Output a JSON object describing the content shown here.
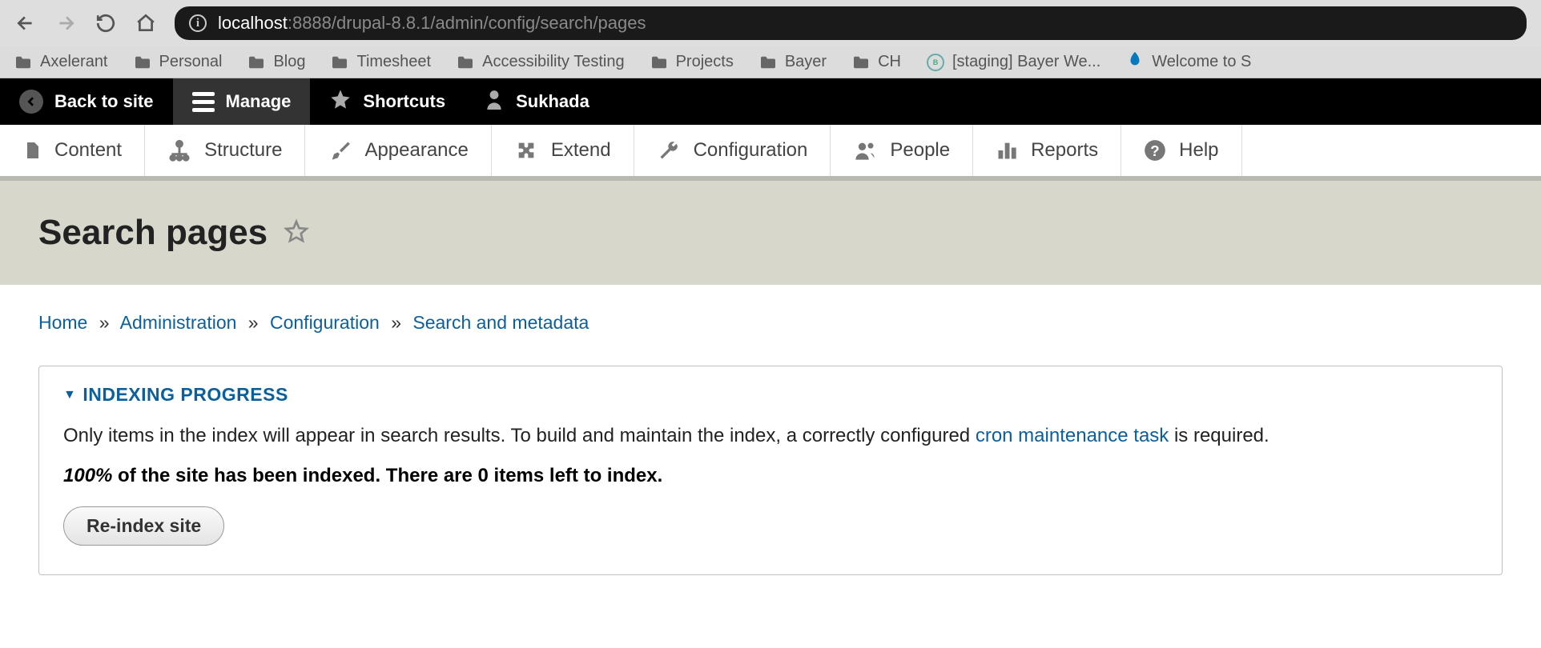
{
  "browser": {
    "url_host": "localhost",
    "url_rest": ":8888/drupal-8.8.1/admin/config/search/pages"
  },
  "bookmarks": [
    {
      "type": "folder",
      "label": "Axelerant"
    },
    {
      "type": "folder",
      "label": "Personal"
    },
    {
      "type": "folder",
      "label": "Blog"
    },
    {
      "type": "folder",
      "label": "Timesheet"
    },
    {
      "type": "folder",
      "label": "Accessibility Testing"
    },
    {
      "type": "folder",
      "label": "Projects"
    },
    {
      "type": "folder",
      "label": "Bayer"
    },
    {
      "type": "folder",
      "label": "CH"
    },
    {
      "type": "bayer",
      "label": "[staging] Bayer We..."
    },
    {
      "type": "drupal",
      "label": "Welcome to S"
    }
  ],
  "toolbar": {
    "back_to_site": "Back to site",
    "manage": "Manage",
    "shortcuts": "Shortcuts",
    "user": "Sukhada"
  },
  "menu": [
    {
      "label": "Content"
    },
    {
      "label": "Structure"
    },
    {
      "label": "Appearance"
    },
    {
      "label": "Extend"
    },
    {
      "label": "Configuration"
    },
    {
      "label": "People"
    },
    {
      "label": "Reports"
    },
    {
      "label": "Help"
    }
  ],
  "page": {
    "title": "Search pages"
  },
  "breadcrumb": {
    "home": "Home",
    "admin": "Administration",
    "config": "Configuration",
    "search": "Search and metadata"
  },
  "indexing": {
    "legend": "INDEXING PROGRESS",
    "desc_pre": "Only items in the index will appear in search results. To build and maintain the index, a correctly configured ",
    "desc_link": "cron maintenance task",
    "desc_post": " is required.",
    "status_pct": "100%",
    "status_rest": " of the site has been indexed. There are 0 items left to index.",
    "reindex_button": "Re-index site"
  }
}
